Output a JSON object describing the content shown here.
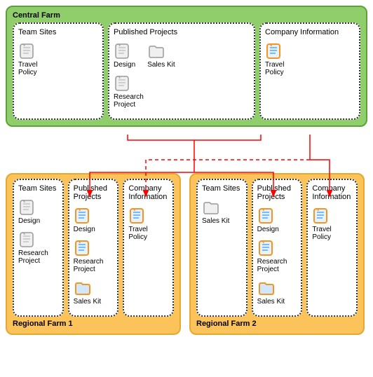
{
  "central": {
    "title": "Central Farm",
    "panels": {
      "team": {
        "title": "Team Sites",
        "items": [
          {
            "label": "Travel\nPolicy",
            "icon": "scroll-gray"
          }
        ]
      },
      "pub": {
        "title": "Published Projects",
        "items": [
          {
            "label": "Design",
            "icon": "scroll-gray"
          },
          {
            "label": "Sales Kit",
            "icon": "folder-gray"
          },
          {
            "label": "Research\nProject",
            "icon": "scroll-gray"
          }
        ]
      },
      "info": {
        "title": "Company Information",
        "items": [
          {
            "label": "Travel\nPolicy",
            "icon": "scroll-blue"
          }
        ]
      }
    }
  },
  "regional1": {
    "title": "Regional Farm 1",
    "panels": {
      "team": {
        "title": "Team Sites",
        "items": [
          {
            "label": "Design",
            "icon": "scroll-gray"
          },
          {
            "label": "Research\nProject",
            "icon": "scroll-gray"
          }
        ]
      },
      "pub": {
        "title": "Published\nProjects",
        "items": [
          {
            "label": "Design",
            "icon": "scroll-blue"
          },
          {
            "label": "Research\nProject",
            "icon": "scroll-blue"
          },
          {
            "label": "Sales Kit",
            "icon": "folder-blue"
          }
        ]
      },
      "info": {
        "title": "Company\nInformation",
        "items": [
          {
            "label": "Travel\nPolicy",
            "icon": "scroll-blue"
          }
        ]
      }
    }
  },
  "regional2": {
    "title": "Regional Farm 2",
    "panels": {
      "team": {
        "title": "Team Sites",
        "items": [
          {
            "label": "Sales Kit",
            "icon": "folder-gray"
          }
        ]
      },
      "pub": {
        "title": "Published\nProjects",
        "items": [
          {
            "label": "Design",
            "icon": "scroll-blue"
          },
          {
            "label": "Research\nProject",
            "icon": "scroll-blue"
          },
          {
            "label": "Sales Kit",
            "icon": "folder-blue"
          }
        ]
      },
      "info": {
        "title": "Company\nInformation",
        "items": [
          {
            "label": "Travel\nPolicy",
            "icon": "scroll-blue"
          }
        ]
      }
    }
  },
  "colors": {
    "central_bg": "#8fce6b",
    "regional_bg": "#fcc35b",
    "arrow": "#ff0000"
  }
}
